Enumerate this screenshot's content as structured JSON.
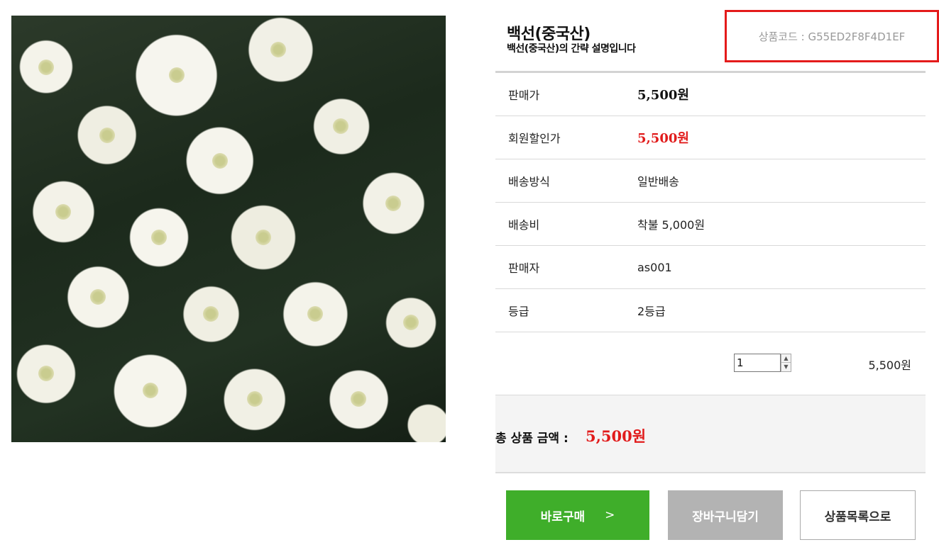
{
  "product": {
    "title": "백선(중국산)",
    "description": "백선(중국산)의 간략 설명입니다",
    "code_text": "상품코드 : G55ED2F8F4D1EF"
  },
  "info_rows": [
    {
      "label": "판매가",
      "value": "5,500원"
    },
    {
      "label": "회원할인가",
      "value": "5,500원"
    },
    {
      "label": "배송방식",
      "value": "일반배송"
    },
    {
      "label": "배송비",
      "value": "착불 5,000원"
    },
    {
      "label": "판매자",
      "value": "as001"
    },
    {
      "label": "등급",
      "value": "2등급"
    }
  ],
  "quantity": {
    "value": "1",
    "line_total": "5,500원"
  },
  "total": {
    "label": "총 상품 금액 :",
    "value": "5,500원"
  },
  "buttons": {
    "buy": "바로구매",
    "buy_arrow": ">",
    "cart": "장바구니담기",
    "list": "상품목록으로"
  },
  "colors": {
    "accent_red": "#e11b1b",
    "buy_green": "#3fae2a",
    "cart_gray": "#b3b3b3"
  }
}
